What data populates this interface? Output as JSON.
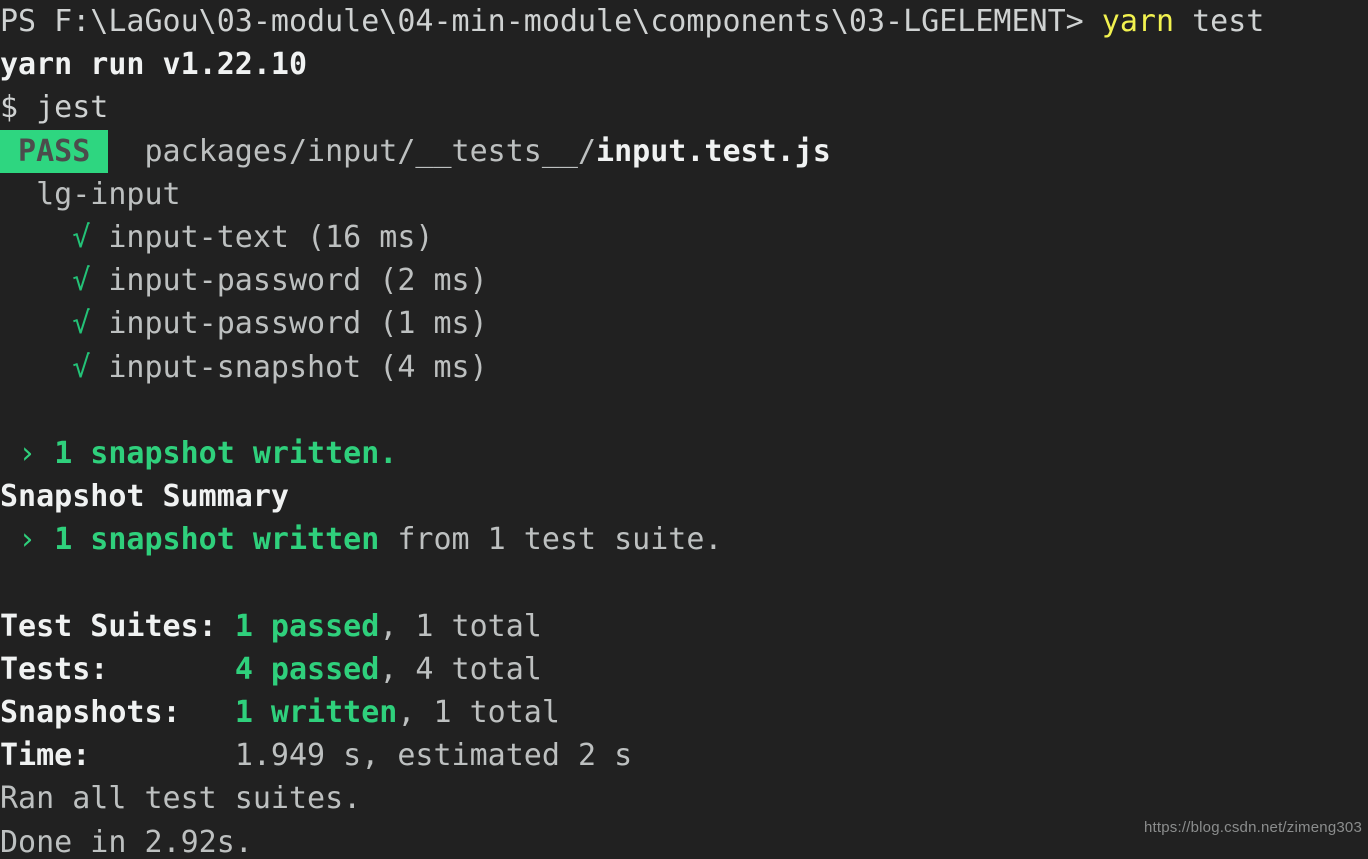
{
  "terminal": {
    "background_color": "#212121",
    "default_text_color": "#cfd2d2",
    "accent_green": "#2fd07c",
    "accent_yellow": "#f2f24f",
    "badge_background": "#2ed680",
    "badge_text_color": "#4c4c4c"
  },
  "prompt": {
    "prefix": "PS F:\\LaGou\\03-module\\04-min-module\\components\\03-LGELEMENT> ",
    "command_name": "yarn",
    "command_space": " ",
    "command_arg": "test"
  },
  "runner": {
    "version_line": "yarn run v1.22.10",
    "exec_line": "$ jest"
  },
  "suite": {
    "status_badge": " PASS ",
    "path_prefix": "  packages/input/__tests__/",
    "path_file": "input.test.js",
    "describe_block": "  lg-input"
  },
  "tests": [
    {
      "indent": "    ",
      "check": "√",
      "name": " input-text",
      "duration": " (16 ms)"
    },
    {
      "indent": "    ",
      "check": "√",
      "name": " input-password",
      "duration": " (2 ms)"
    },
    {
      "indent": "    ",
      "check": "√",
      "name": " input-password",
      "duration": " (1 ms)"
    },
    {
      "indent": "    ",
      "check": "√",
      "name": " input-snapshot",
      "duration": " (4 ms)"
    }
  ],
  "snapshot_notice": {
    "arrow": " › ",
    "text": "1 snapshot written."
  },
  "snapshot_summary": {
    "heading": "Snapshot Summary",
    "arrow": " › ",
    "highlight": "1 snapshot written",
    "rest": " from 1 test suite."
  },
  "summary": {
    "rows": [
      {
        "label": "Test Suites: ",
        "highlight": "1 passed",
        "rest": ", 1 total"
      },
      {
        "label": "Tests:       ",
        "highlight": "4 passed",
        "rest": ", 4 total"
      },
      {
        "label": "Snapshots:   ",
        "highlight": "1 written",
        "rest": ", 1 total"
      },
      {
        "label": "Time:        ",
        "highlight": "",
        "rest": "1.949 s, estimated 2 s"
      }
    ]
  },
  "footer": {
    "ran_all": "Ran all test suites.",
    "done": "Done in 2.92s."
  },
  "watermark": {
    "text": "https://blog.csdn.net/zimeng303"
  }
}
